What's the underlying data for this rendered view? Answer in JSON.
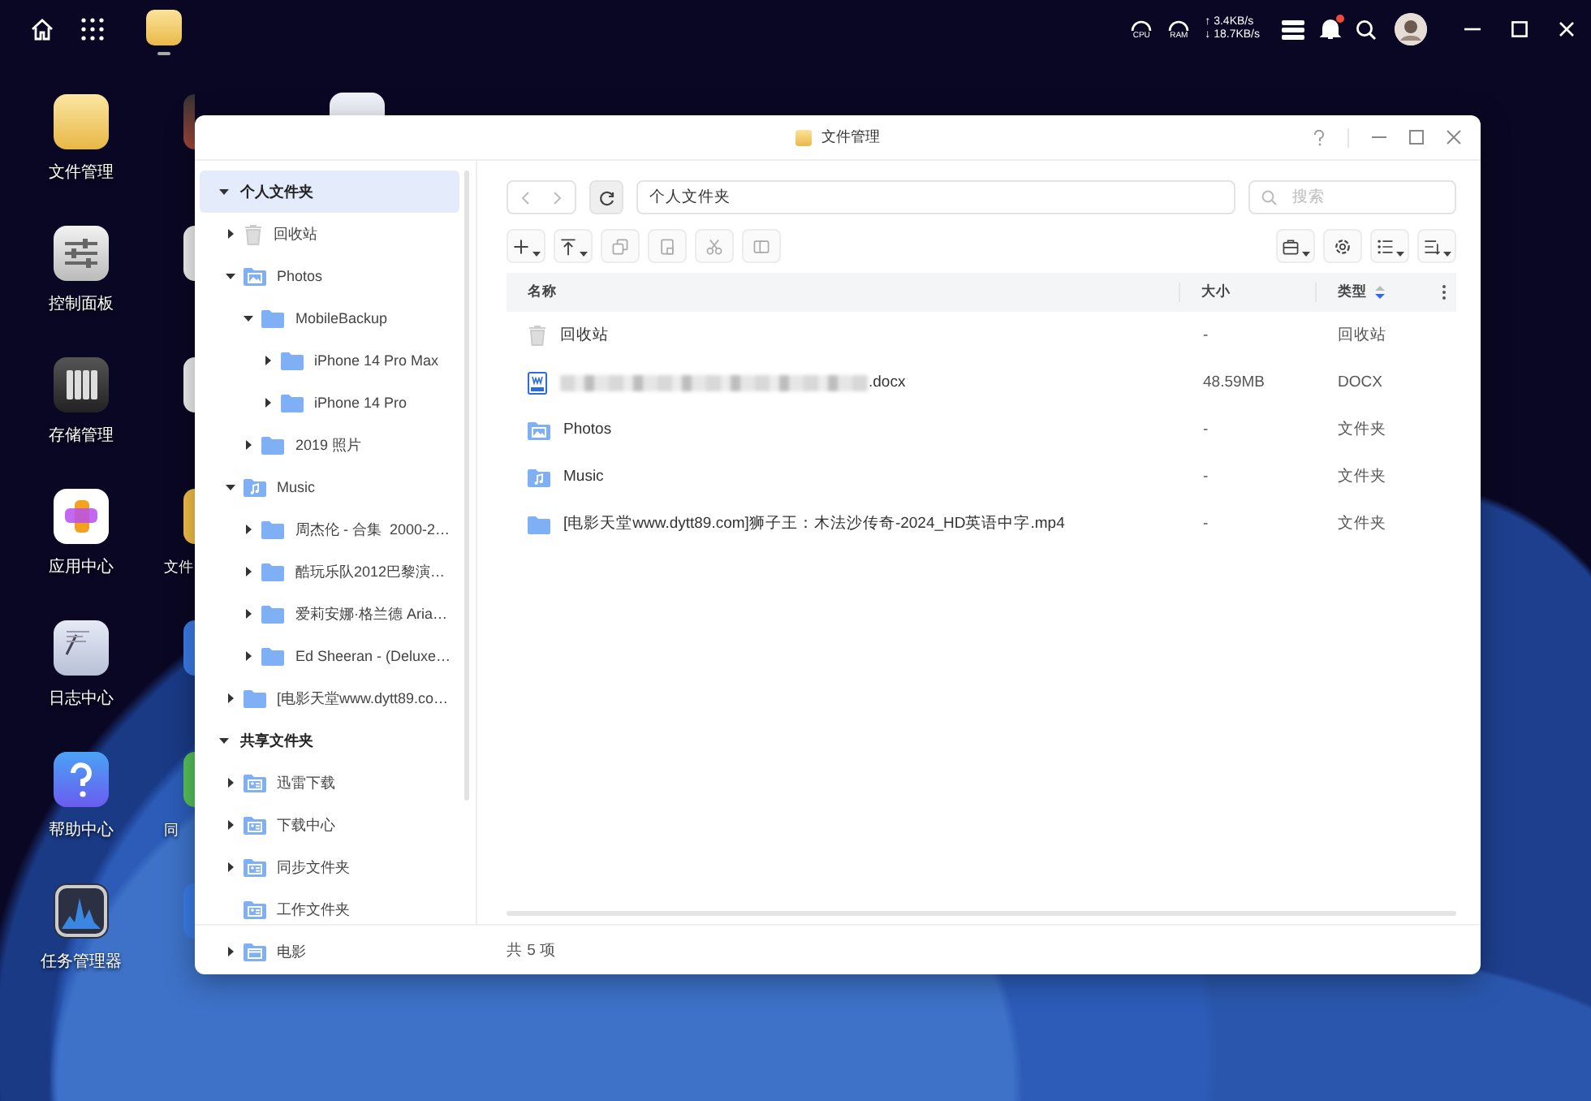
{
  "topbar": {
    "pinned_apps": [
      {
        "kind": "files",
        "selected": true
      }
    ],
    "cpu_label": "CPU",
    "ram_label": "RAM",
    "upload": "↑ 3.4KB/s",
    "download": "↓ 18.7KB/s",
    "notification": true
  },
  "desktop": {
    "icons": [
      {
        "kind": "files",
        "label": "文件管理"
      },
      {
        "kind": "control",
        "label": "控制面板"
      },
      {
        "kind": "storage",
        "label": "存储管理"
      },
      {
        "kind": "apps",
        "label": "应用中心"
      },
      {
        "kind": "logs",
        "label": "日志中心"
      },
      {
        "kind": "help",
        "label": "帮助中心"
      },
      {
        "kind": "monitor",
        "label": "任务管理器"
      }
    ],
    "hidden_icons": [
      {
        "kind": "video"
      },
      {
        "kind": "white"
      },
      {
        "kind": "white"
      },
      {
        "kind": "yellow",
        "label": "文件"
      },
      {
        "kind": "blue"
      },
      {
        "kind": "green",
        "label": "同"
      },
      {
        "kind": "blue"
      }
    ]
  },
  "window": {
    "title": "文件管理",
    "sidebar": {
      "items": [
        {
          "kind": "section",
          "label": "个人文件夹",
          "has_children": true,
          "expanded": true,
          "selected": true,
          "children": [
            {
              "kind": "trash",
              "label": "回收站",
              "has_children": true,
              "expanded": false,
              "selected": false
            },
            {
              "kind": "photos",
              "label": "Photos",
              "has_children": true,
              "expanded": true,
              "selected": false,
              "children": [
                {
                  "kind": "folder",
                  "label": "MobileBackup",
                  "has_children": true,
                  "expanded": true,
                  "selected": false,
                  "children": [
                    {
                      "kind": "folder",
                      "label": "iPhone 14 Pro Max",
                      "has_children": true,
                      "expanded": false,
                      "selected": false
                    },
                    {
                      "kind": "folder",
                      "label": "iPhone 14 Pro",
                      "has_children": true,
                      "expanded": false,
                      "selected": false
                    }
                  ]
                },
                {
                  "kind": "folder",
                  "label": "2019 照片",
                  "has_children": true,
                  "expanded": false,
                  "selected": false
                }
              ]
            },
            {
              "kind": "music",
              "label": "Music",
              "has_children": true,
              "expanded": true,
              "selected": false,
              "children": [
                {
                  "kind": "folder",
                  "label": "周杰伦 - 合集  2000-2…",
                  "has_children": true,
                  "expanded": false,
                  "selected": false
                },
                {
                  "kind": "folder",
                  "label": "酷玩乐队2012巴黎演…",
                  "has_children": true,
                  "expanded": false,
                  "selected": false
                },
                {
                  "kind": "folder",
                  "label": "爱莉安娜·格兰德 Aria…",
                  "has_children": true,
                  "expanded": false,
                  "selected": false
                },
                {
                  "kind": "folder",
                  "label": "Ed Sheeran - (Deluxe…",
                  "has_children": true,
                  "expanded": false,
                  "selected": false
                }
              ]
            },
            {
              "kind": "folder",
              "label": "[电影天堂www.dytt89.co…",
              "has_children": true,
              "expanded": false,
              "selected": false
            }
          ]
        },
        {
          "kind": "section",
          "label": "共享文件夹",
          "has_children": true,
          "expanded": true,
          "selected": false,
          "children": [
            {
              "kind": "shared",
              "label": "迅雷下载",
              "has_children": true,
              "expanded": false,
              "selected": false
            },
            {
              "kind": "shared",
              "label": "下载中心",
              "has_children": true,
              "expanded": false,
              "selected": false
            },
            {
              "kind": "shared",
              "label": "同步文件夹",
              "has_children": true,
              "expanded": false,
              "selected": false
            },
            {
              "kind": "shared",
              "label": "工作文件夹",
              "has_children": false,
              "selected": false
            },
            {
              "kind": "video",
              "label": "电影",
              "has_children": true,
              "expanded": false,
              "selected": false
            }
          ]
        }
      ]
    },
    "path": "个人文件夹",
    "search": {
      "placeholder": "搜索"
    },
    "toolbar_left": [
      {
        "kind": "add",
        "dropdown": true,
        "disabled": false
      },
      {
        "kind": "upload",
        "dropdown": true,
        "disabled": false
      },
      {
        "kind": "copy",
        "dropdown": false,
        "disabled": true
      },
      {
        "kind": "paste",
        "dropdown": false,
        "disabled": true
      },
      {
        "kind": "cut",
        "dropdown": false,
        "disabled": true
      },
      {
        "kind": "move",
        "dropdown": false,
        "disabled": true
      }
    ],
    "toolbar_right": [
      {
        "kind": "toolbox",
        "dropdown": true,
        "disabled": false
      },
      {
        "kind": "settings",
        "dropdown": false,
        "disabled": false
      },
      {
        "kind": "list",
        "dropdown": true,
        "disabled": false
      },
      {
        "kind": "sort",
        "dropdown": true,
        "disabled": false
      }
    ],
    "table": {
      "columns": [
        {
          "label": "名称",
          "sorted": false
        },
        {
          "label": "大小",
          "sorted": false
        },
        {
          "label": "类型",
          "sorted": true
        }
      ],
      "rows": [
        {
          "kind": "trash",
          "name": "回收站",
          "redacted": false,
          "size": "-",
          "type": "回收站"
        },
        {
          "kind": "docx",
          "name": ".docx",
          "redacted": true,
          "size": "48.59MB",
          "type": "DOCX"
        },
        {
          "kind": "photos",
          "name": "Photos",
          "redacted": false,
          "size": "-",
          "type": "文件夹"
        },
        {
          "kind": "music",
          "name": "Music",
          "redacted": false,
          "size": "-",
          "type": "文件夹"
        },
        {
          "kind": "folder",
          "name": "[电影天堂www.dytt89.com]狮子王：木法沙传奇-2024_HD英语中字.mp4",
          "redacted": false,
          "size": "-",
          "type": "文件夹"
        }
      ]
    },
    "status": "共 5 项"
  }
}
